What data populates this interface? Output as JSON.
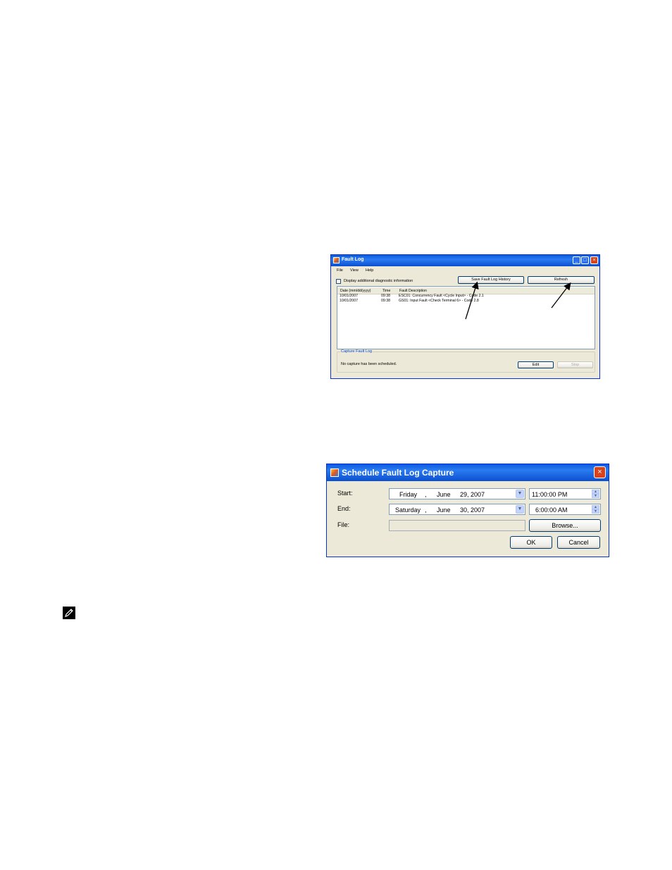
{
  "fault_log": {
    "title": "Fault Log",
    "menu": [
      "File",
      "View",
      "Help"
    ],
    "checkbox_label": "Display additional diagnostic information",
    "save_button": "Save Fault Log History",
    "refresh_button": "Refresh",
    "columns": [
      "Date (mm/dd/yyyy)",
      "Time",
      "Fault Description"
    ],
    "rows": [
      [
        "10/01/2007",
        "09:38",
        "ESC01: Concurrency Fault <Cycle Input> - Code 2.1"
      ],
      [
        "10/01/2007",
        "09:38",
        "GS01: Input Fault <Check Terminal 6> - Code 2.8"
      ]
    ],
    "capture_group_title": "Capture Fault Log",
    "capture_status": "No capture has been scheduled.",
    "edit_button": "Edit",
    "stop_button": "Stop"
  },
  "schedule": {
    "title": "Schedule Fault Log Capture",
    "start_label": "Start:",
    "end_label": "End:",
    "file_label": "File:",
    "start_date": {
      "weekday": "Friday",
      "month": "June",
      "day_year": "29, 2007"
    },
    "start_time": "11:00:00 PM",
    "end_date": {
      "weekday": "Saturday",
      "month": "June",
      "day_year": "30, 2007"
    },
    "end_time": "6:00:00 AM",
    "file_value": "",
    "browse_button": "Browse...",
    "ok_button": "OK",
    "cancel_button": "Cancel"
  },
  "icons": [
    "app-icon",
    "minimize-icon",
    "maximize-icon",
    "close-icon",
    "dropdown-arrow-icon",
    "spin-up-icon",
    "spin-down-icon",
    "note-icon"
  ]
}
